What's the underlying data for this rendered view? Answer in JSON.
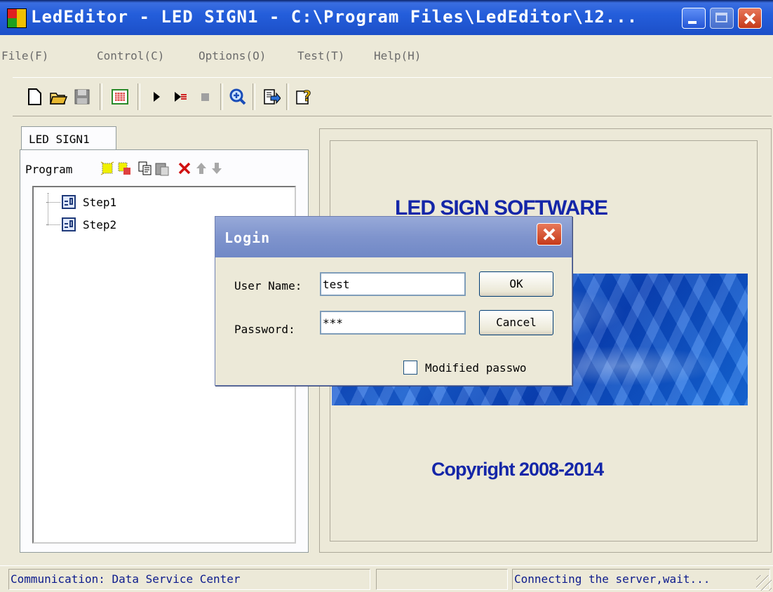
{
  "window": {
    "title": "LedEditor - LED SIGN1 - C:\\Program Files\\LedEditor\\12...",
    "icon": "led-app-icon",
    "colors": {
      "titlebar": "#245edb",
      "brand_text": "#1426a8"
    }
  },
  "menu": {
    "items": [
      "File(F)",
      "Control(C)",
      "Options(O)",
      "Test(T)",
      "Help(H)"
    ]
  },
  "toolbar": {
    "icons": [
      "new-document-icon",
      "open-folder-icon",
      "save-icon",
      "led-grid-icon",
      "play-icon",
      "play-step-icon",
      "stop-icon",
      "zoom-icon",
      "export-icon",
      "help-icon"
    ]
  },
  "tabs": [
    "LED SIGN1"
  ],
  "program": {
    "label": "Program",
    "tools": [
      "add-program-icon",
      "add-area-icon",
      "copy-icon",
      "paste-icon",
      "delete-icon",
      "move-up-icon",
      "move-down-icon"
    ],
    "tree": [
      "Step1",
      "Step2"
    ]
  },
  "preview": {
    "title": "LED SIGN SOFTWARE",
    "copyright": "Copyright 2008-2014"
  },
  "login": {
    "title": "Login",
    "username_label": "User Name:",
    "username_value": "test",
    "password_label": "Password:",
    "password_value": "***",
    "ok": "OK",
    "cancel": "Cancel",
    "modify_label": "Modified passwo",
    "modify_checked": false
  },
  "status": {
    "left": "Communication: Data Service Center",
    "middle": "",
    "right": "Connecting the server,wait..."
  }
}
